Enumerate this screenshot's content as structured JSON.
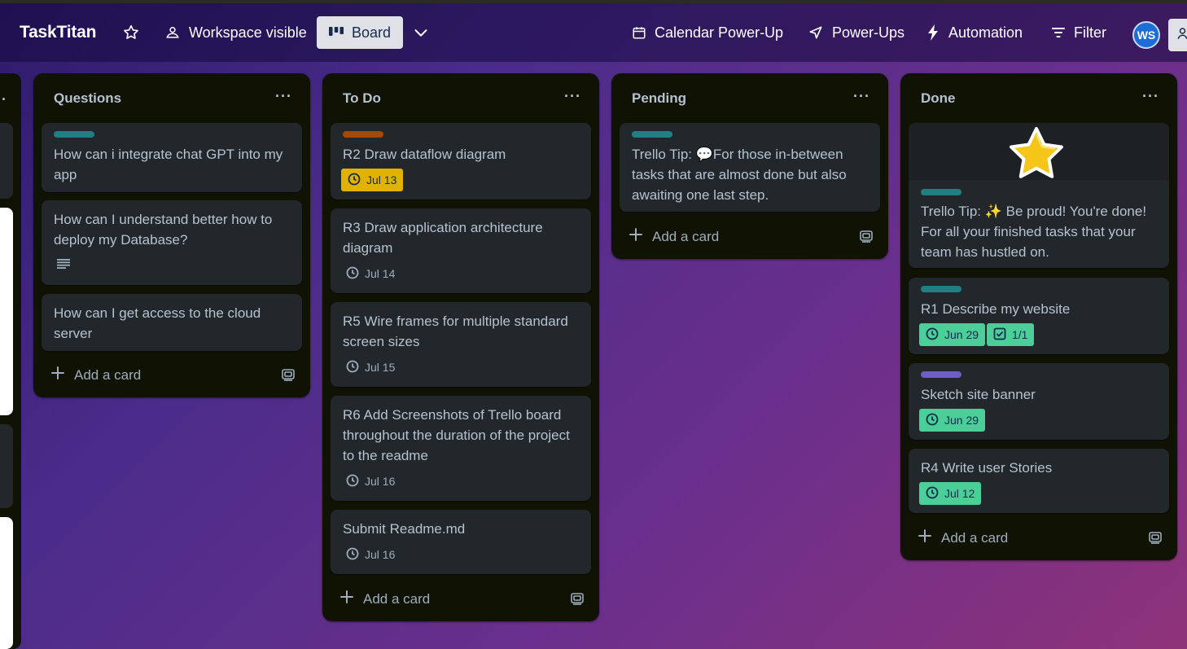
{
  "header": {
    "board_name": "TaskTitan",
    "visibility": "Workspace visible",
    "view": "Board",
    "calendar": "Calendar Power-Up",
    "powerups": "Power-Ups",
    "automation": "Automation",
    "filter": "Filter",
    "avatar_initials": "WS"
  },
  "lists": [
    {
      "title": "Questions",
      "menu": "···",
      "cards": [
        {
          "label_color": "#1f7f83",
          "text": "How can i integrate chat GPT into my app"
        },
        {
          "text": "How can I understand better how to deploy my Database?",
          "has_description": true
        },
        {
          "text": "How can I get access to the cloud server"
        }
      ],
      "add_label": "Add a card"
    },
    {
      "title": "To Do",
      "menu": "···",
      "cards": [
        {
          "label_color": "#a54800",
          "text": "R2 Draw dataflow diagram",
          "due": "Jul 13",
          "due_style": "yellow"
        },
        {
          "text": "R3 Draw application architecture diagram",
          "due": "Jul 14"
        },
        {
          "text": "R5 Wire frames for multiple standard screen sizes",
          "due": "Jul 15"
        },
        {
          "text": "R6 Add Screenshots of Trello board throughout the duration of the project to the readme",
          "due": "Jul 16"
        },
        {
          "text": "Submit Readme.md",
          "due": "Jul 16"
        }
      ],
      "add_label": "Add a card"
    },
    {
      "title": "Pending",
      "menu": "···",
      "cards": [
        {
          "label_color": "#1f7f83",
          "text": "Trello Tip: 💬For those in-between tasks that are almost done but also awaiting one last step."
        }
      ],
      "add_label": "Add a card"
    },
    {
      "title": "Done",
      "menu": "···",
      "cards": [
        {
          "label_color": "#1f7f83",
          "text": "Trello Tip: ✨ Be proud! You're done! For all your finished tasks that your team has hustled on.",
          "cover": "star"
        },
        {
          "label_color": "#1f7f83",
          "text": "R1 Describe my website",
          "due": "Jun 29",
          "due_style": "green",
          "checklist": "1/1"
        },
        {
          "label_color": "#6e5dc6",
          "text": "Sketch site banner",
          "due": "Jun 29",
          "due_style": "green"
        },
        {
          "text": "R4 Write user Stories",
          "due": "Jul 12",
          "due_style": "green"
        }
      ],
      "add_label": "Add a card"
    }
  ]
}
